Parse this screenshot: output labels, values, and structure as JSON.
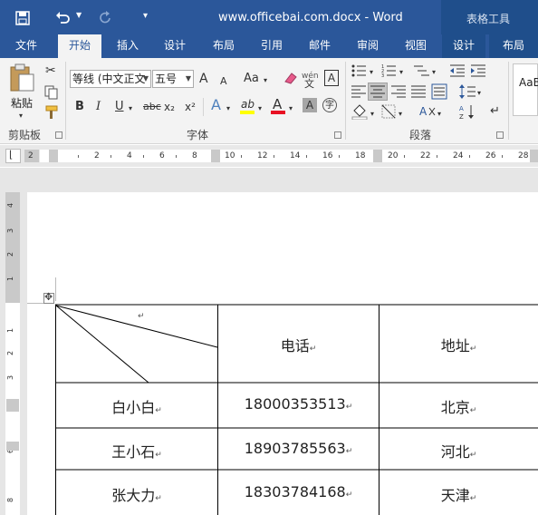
{
  "window": {
    "title": "www.officebai.com.docx - Word",
    "context_tools": "表格工具"
  },
  "tabs": [
    {
      "label": "文件"
    },
    {
      "label": "开始",
      "active": true
    },
    {
      "label": "插入"
    },
    {
      "label": "设计"
    },
    {
      "label": "布局"
    },
    {
      "label": "引用"
    },
    {
      "label": "邮件"
    },
    {
      "label": "审阅"
    },
    {
      "label": "视图"
    },
    {
      "label": "设计"
    },
    {
      "label": "布局"
    }
  ],
  "ribbon": {
    "clipboard": {
      "group_label": "剪贴板",
      "paste_label": "粘贴"
    },
    "font": {
      "group_label": "字体",
      "font_name": "等线 (中文正文",
      "font_size": "五号",
      "grow_font": "A",
      "shrink_font": "A",
      "change_case": "Aa",
      "phonetic": "wén",
      "bold": "B",
      "italic": "I",
      "underline": "U",
      "strike": "abc",
      "subscript": "x₂",
      "superscript": "x²",
      "text_effect": "A",
      "highlight": "ab",
      "font_color": "A",
      "char_shading": "A",
      "enclose": "字"
    },
    "paragraph": {
      "group_label": "段落"
    },
    "styles": {
      "preview": "AaBl"
    }
  },
  "ruler": {
    "labels": [
      "2",
      "2",
      "4",
      "6",
      "8",
      "10",
      "12",
      "14",
      "16",
      "18",
      "20",
      "22",
      "24",
      "26",
      "28"
    ]
  },
  "vruler": {
    "labels": [
      "4",
      "3",
      "2",
      "1",
      "1",
      "2",
      "3",
      "4",
      "6",
      "8"
    ]
  },
  "table": {
    "header": [
      "",
      "电话",
      "地址"
    ],
    "rows": [
      [
        "白小白",
        "18000353513",
        "北京"
      ],
      [
        "王小石",
        "18903785563",
        "河北"
      ],
      [
        "张大力",
        "18303784168",
        "天津"
      ]
    ],
    "paragraph_mark": "↵"
  },
  "colors": {
    "accent": "#2b579a",
    "ribbon_bg": "#f3f3f3",
    "doc_bg": "#e6e6e6"
  }
}
